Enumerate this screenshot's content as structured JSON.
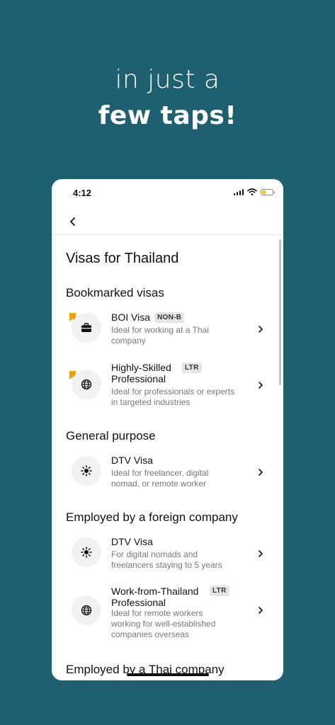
{
  "hero": {
    "line1": "in just a",
    "line2": "few taps!"
  },
  "status_bar": {
    "time": "4:12",
    "battery_level": 0.25,
    "battery_color": "#f2c230"
  },
  "nav": {
    "back_icon": "chevron-left-icon"
  },
  "page": {
    "title": "Visas for Thailand"
  },
  "sections": {
    "bookmarked": {
      "title": "Bookmarked visas",
      "items": [
        {
          "title": "BOI Visa",
          "badge": "NON-B",
          "desc": "Ideal for working at a Thai company",
          "icon": "briefcase-icon",
          "bookmarked": true
        },
        {
          "title": "Highly-Skilled Professional",
          "badge": "LTR",
          "desc": "Ideal for professionals or experts in targeted industries",
          "icon": "globe-icon",
          "bookmarked": true
        }
      ]
    },
    "general": {
      "title": "General purpose",
      "items": [
        {
          "title": "DTV Visa",
          "desc": "Ideal for freelancer, digital nomad, or remote worker",
          "icon": "sun-icon"
        }
      ]
    },
    "foreign": {
      "title": "Employed by a foreign company",
      "items": [
        {
          "title": "DTV Visa",
          "desc": "For digital nomads and freelancers staying to 5 years",
          "icon": "sun-icon"
        },
        {
          "title": "Work-from-Thailand Professional",
          "badge": "LTR",
          "desc": "Ideal for remote workers working for well-established companies overseas",
          "icon": "globe-icon"
        }
      ]
    },
    "thai": {
      "title": "Employed by a Thai company"
    }
  },
  "colors": {
    "background": "#1f6070",
    "bookmark": "#e8a31c",
    "badge_bg": "#e5e5e5"
  }
}
